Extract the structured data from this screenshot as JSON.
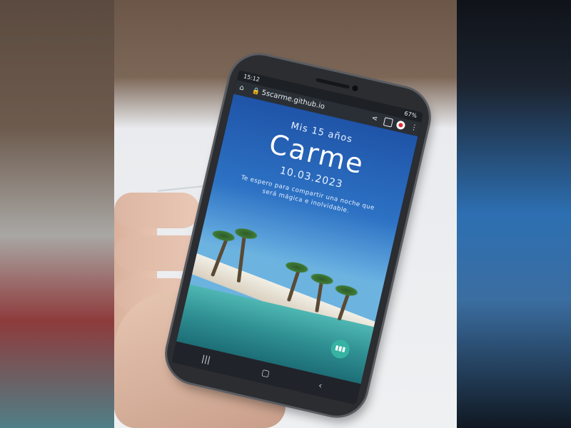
{
  "status_bar": {
    "time": "15:12",
    "battery": "67%"
  },
  "browser": {
    "url": "5scarme.github.io"
  },
  "invitation": {
    "subtitle": "Mis 15 años",
    "name": "Carme",
    "date": "10.03.2023",
    "message": "Te espero para compartir una noche que será mágica e inolvidable."
  },
  "icons": {
    "home": "home-icon",
    "lock": "lock-icon",
    "share": "share-icon",
    "tabs": "tabs-icon",
    "record": "record-icon",
    "menu": "menu-icon",
    "music": "music-bars-icon",
    "nav_recents": "recents-icon",
    "nav_home": "home-circle-icon",
    "nav_back": "back-icon"
  },
  "colors": {
    "sky_top": "#1f54a8",
    "sky_mid": "#2d72c4",
    "water": "#2f8f92",
    "fab": "#36b3a2",
    "phone_frame": "#2b2d31"
  }
}
